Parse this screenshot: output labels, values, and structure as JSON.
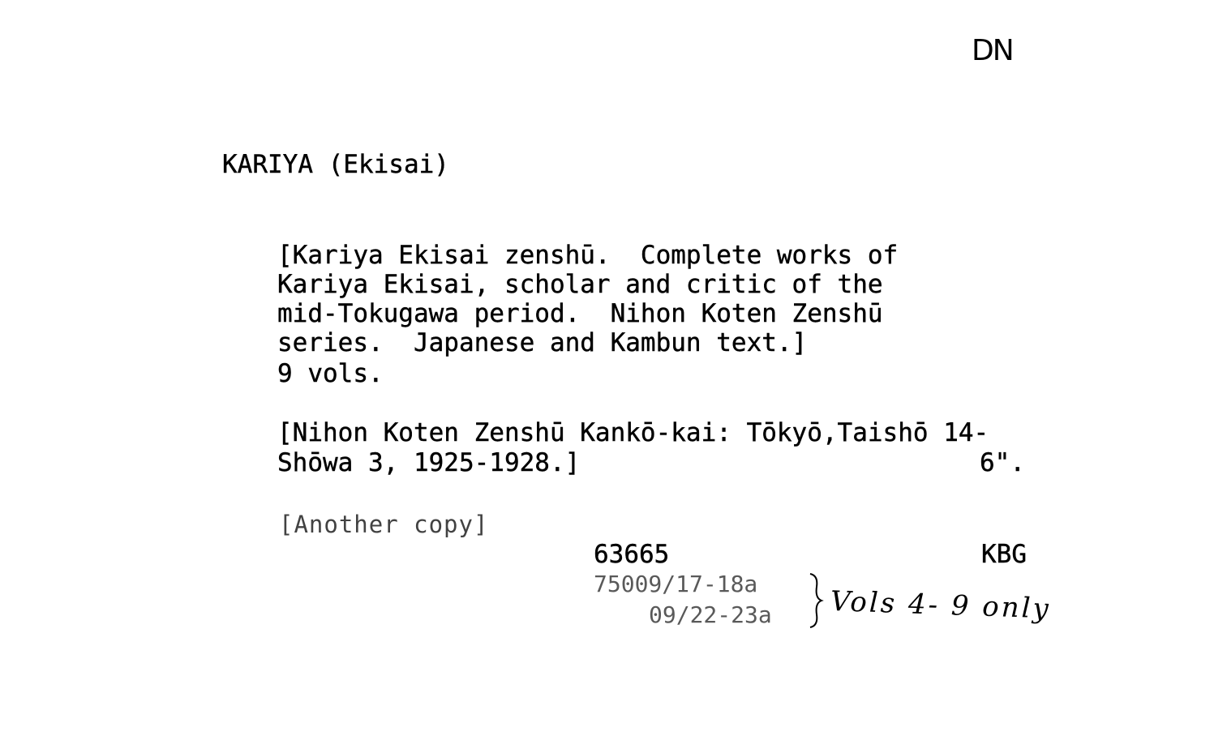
{
  "card": {
    "corner_initials": "DN",
    "heading": "KARIYA (Ekisai)",
    "description_lines": [
      "[Kariya Ekisai zenshū.  Complete works of",
      "Kariya Ekisai, scholar and critic of the",
      "mid-Tokugawa period.  Nihon Koten Zenshū",
      "series.  Japanese and Kambun text.]",
      "9 vols."
    ],
    "imprint_lines": [
      "[Nihon Koten Zenshū Kankō-kai: Tōkyō,Taishō 14-",
      "Shōwa 3, 1925-1928.]"
    ],
    "size": "6\".",
    "another_copy": "[Another copy]",
    "accession_number": "63665",
    "location_code": "KBG",
    "shelfmarks": [
      "75009/17-18a",
      "09/22-23a"
    ],
    "handwritten_note": "Vols 4- 9 only"
  }
}
